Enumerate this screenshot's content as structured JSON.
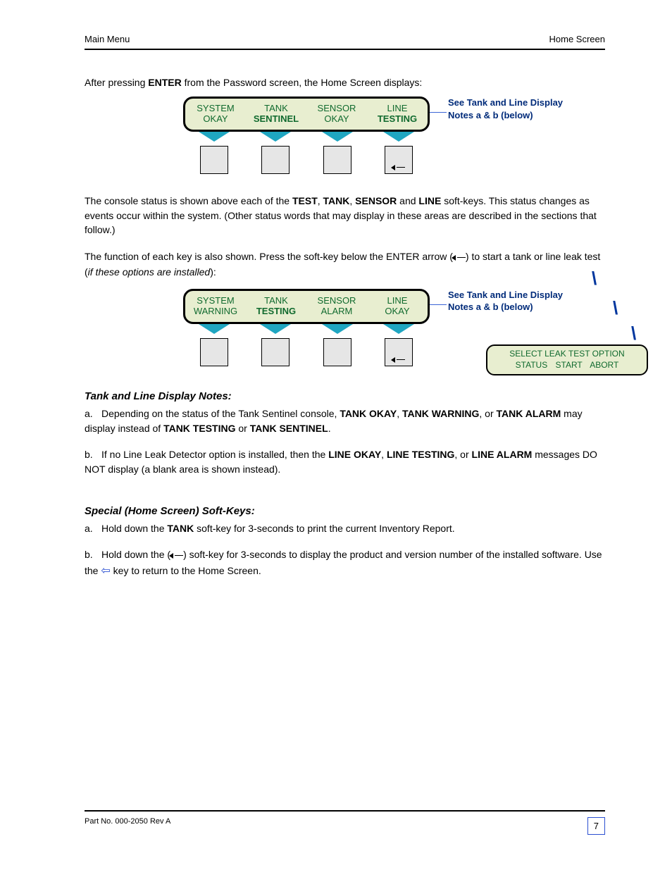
{
  "header": {
    "left": "Main Menu",
    "right": "Home Screen"
  },
  "intro": {
    "line1_pre": "After pressing ",
    "line1_enter": "ENTER",
    "line1_post": " from the Password screen, the Home Screen displays:"
  },
  "lcd1": {
    "cells": [
      {
        "l1": "SYSTEM",
        "l2": "OKAY",
        "bold": false
      },
      {
        "l1": "TANK",
        "l2": "SENTINEL",
        "bold": true
      },
      {
        "l1": "SENSOR",
        "l2": "OKAY",
        "bold": false
      },
      {
        "l1": "LINE",
        "l2": "TESTING",
        "bold": true
      }
    ],
    "note": "See Tank and Line Display Notes a & b (below)"
  },
  "para1": {
    "pre": "The console status is shown above each of the ",
    "b1": "TEST",
    "mid1": ", ",
    "b2": "TANK",
    "mid2": ", ",
    "b3": "SENSOR",
    "mid3": " and ",
    "b4": "LINE",
    "post": " soft-keys. This status changes as events occur within the system. (Other status words that may display in these areas are described in the sections that follow.)"
  },
  "para2": {
    "text": "The function of each key is also shown. Press the",
    "key": "soft-key below the ENTER arrow (",
    "post1": ") to start a tank or line leak test (",
    "emph": "if these options are installed",
    "post2": "):"
  },
  "lcd2": {
    "cells": [
      {
        "l1": "SYSTEM",
        "l2": "WARNING",
        "bold": false
      },
      {
        "l1": "TANK",
        "l2": "TESTING",
        "bold": true
      },
      {
        "l1": "SENSOR",
        "l2": "ALARM",
        "bold": false
      },
      {
        "l1": "LINE",
        "l2": "OKAY",
        "bold": false
      }
    ],
    "note": "See Tank and Line Display Notes a & b (below)",
    "popup": {
      "l1": "SELECT LEAK TEST OPTION",
      "l2": "STATUS   START   ABORT"
    }
  },
  "displaynotes": {
    "heading": "Tank and Line Display Notes:",
    "a_label": "a.",
    "a_pre": "Depending on the status of the Tank Sentinel console, ",
    "a_b1": "TANK OKAY",
    "a_mid1": ", ",
    "a_b2": "TANK WARNING",
    "a_mid2": ", or ",
    "a_b3": "TANK ALARM",
    "a_mid3": " may display instead of ",
    "a_b4": "TANK TESTING",
    "a_mid4": " or ",
    "a_b5": "TANK SENTINEL",
    "a_post": ".",
    "b_label": "b.",
    "b_pre": "If no Line Leak Detector option is installed, then the ",
    "b_b1": "LINE OKAY",
    "b_mid1": ", ",
    "b_b2": "LINE TESTING",
    "b_mid2": ", or ",
    "b_b3": "LINE ALARM",
    "b_post": " messages DO NOT display (a blank area is shown instead)."
  },
  "softkeys": {
    "heading": "Special (Home Screen) Soft-Keys:",
    "a_label": "a.",
    "a_text_pre": "Hold down the ",
    "a_b1": "TANK",
    "a_text_mid": " soft-key for 3-seconds to print the current Inventory Report.",
    "b_label": "b.",
    "b_text_pre": "Hold down the (",
    "b_text_post": ") soft-key for 3-seconds to display the product and version number of the installed software. Use the  ",
    "b_arrow": "⇦",
    "b_text_end": "  key to return to the Home Screen."
  },
  "footer": {
    "left": "Part No. 000-2050 Rev A",
    "page": "7"
  }
}
